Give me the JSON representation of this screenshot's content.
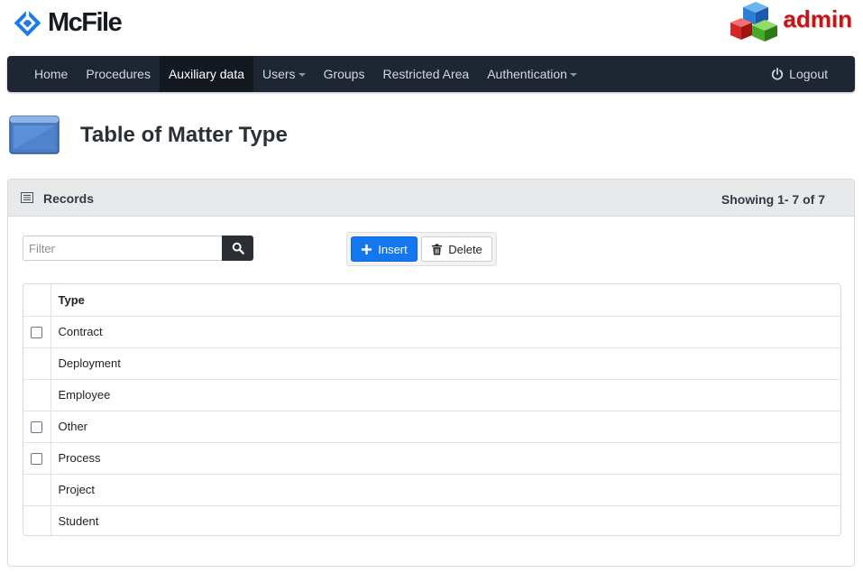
{
  "header": {
    "logo_text": "McFile",
    "admin_label": "admin"
  },
  "nav": {
    "items": [
      {
        "label": "Home",
        "active": false,
        "dropdown": false
      },
      {
        "label": "Procedures",
        "active": false,
        "dropdown": false
      },
      {
        "label": "Auxiliary data",
        "active": true,
        "dropdown": false
      },
      {
        "label": "Users",
        "active": false,
        "dropdown": true
      },
      {
        "label": "Groups",
        "active": false,
        "dropdown": false
      },
      {
        "label": "Restricted Area",
        "active": false,
        "dropdown": false
      },
      {
        "label": "Authentication",
        "active": false,
        "dropdown": true
      }
    ],
    "logout_label": "Logout"
  },
  "page": {
    "title": "Table of Matter Type"
  },
  "panel": {
    "title": "Records",
    "count_text": "Showing 1- 7 of 7",
    "filter_placeholder": "Filter",
    "insert_label": "Insert",
    "delete_label": "Delete"
  },
  "table": {
    "column": "Type",
    "rows": [
      {
        "type": "Contract",
        "checkbox": true
      },
      {
        "type": "Deployment",
        "checkbox": false
      },
      {
        "type": "Employee",
        "checkbox": false
      },
      {
        "type": "Other",
        "checkbox": true
      },
      {
        "type": "Process",
        "checkbox": true
      },
      {
        "type": "Project",
        "checkbox": false
      },
      {
        "type": "Student",
        "checkbox": false
      }
    ]
  },
  "colors": {
    "navbar": "#1f2633",
    "nav_active": "#141921",
    "primary": "#1577f0",
    "admin_red": "#c01818"
  }
}
